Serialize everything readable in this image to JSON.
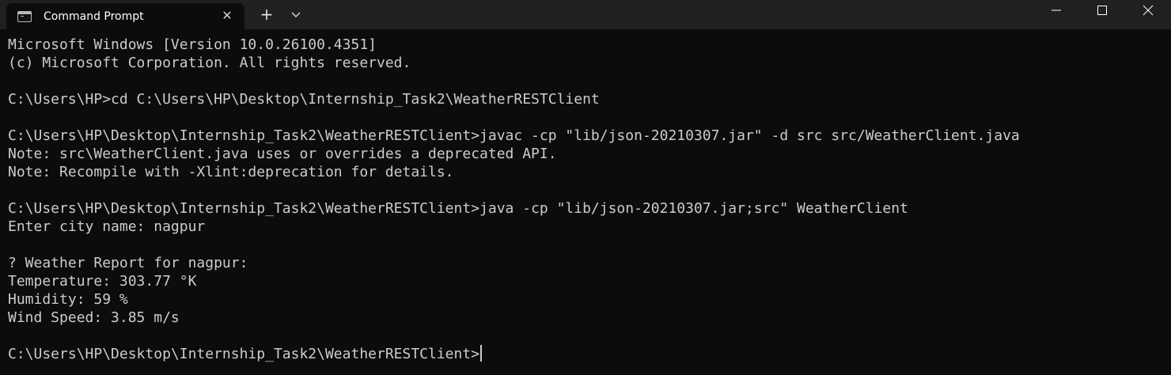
{
  "window": {
    "tab_title": "Command Prompt",
    "tab_close_glyph": "✕",
    "new_tab_glyph": "+",
    "icons": {
      "tab": "cmd-icon",
      "close_tab": "close-icon",
      "new_tab": "plus-icon",
      "dropdown": "chevron-down-icon",
      "minimize": "minimize-icon",
      "maximize": "maximize-icon",
      "close": "close-icon"
    },
    "colors": {
      "titlebar": "#202020",
      "background": "#0c0c0c",
      "text": "#cccccc"
    }
  },
  "terminal": {
    "lines": [
      "Microsoft Windows [Version 10.0.26100.4351]",
      "(c) Microsoft Corporation. All rights reserved.",
      "",
      "C:\\Users\\HP>cd C:\\Users\\HP\\Desktop\\Internship_Task2\\WeatherRESTClient",
      "",
      "C:\\Users\\HP\\Desktop\\Internship_Task2\\WeatherRESTClient>javac -cp \"lib/json-20210307.jar\" -d src src/WeatherClient.java",
      "Note: src\\WeatherClient.java uses or overrides a deprecated API.",
      "Note: Recompile with -Xlint:deprecation for details.",
      "",
      "C:\\Users\\HP\\Desktop\\Internship_Task2\\WeatherRESTClient>java -cp \"lib/json-20210307.jar;src\" WeatherClient",
      "Enter city name: nagpur",
      "",
      "? Weather Report for nagpur:",
      "Temperature: 303.77 °K",
      "Humidity: 59 %",
      "Wind Speed: 3.85 m/s",
      "",
      "C:\\Users\\HP\\Desktop\\Internship_Task2\\WeatherRESTClient>"
    ]
  }
}
